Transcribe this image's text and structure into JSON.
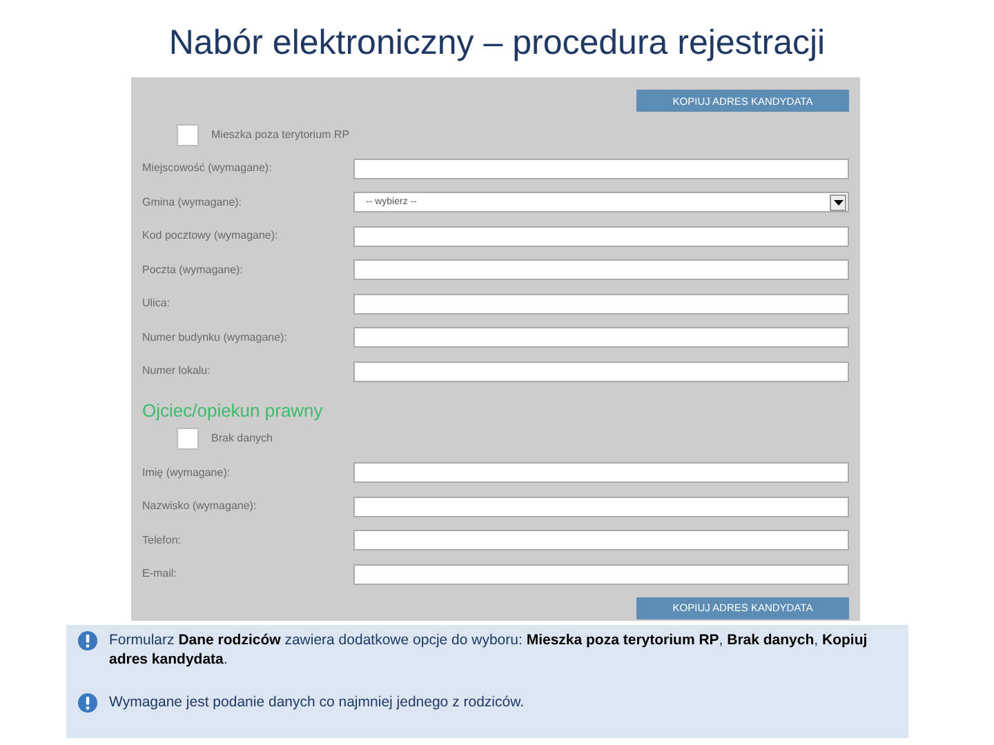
{
  "title": "Nabór elektroniczny – procedura rejestracji",
  "form": [
    {
      "kind": "button",
      "label": "KOPIUJ ADRES KANDYDATA"
    },
    {
      "kind": "checkbox",
      "label": "Mieszka poza terytorium RP",
      "checked": false
    },
    {
      "kind": "field",
      "label": "Miejscowość (wymagane):"
    },
    {
      "kind": "select",
      "label": "Gmina (wymagane):",
      "value": "-- wybierz --"
    },
    {
      "kind": "field",
      "label": "Kod pocztowy (wymagane):"
    },
    {
      "kind": "field",
      "label": "Poczta (wymagane):"
    },
    {
      "kind": "field",
      "label": "Ulica:"
    },
    {
      "kind": "field",
      "label": "Numer budynku (wymagane):"
    },
    {
      "kind": "field",
      "label": "Numer lokalu:"
    },
    {
      "kind": "heading",
      "label": "Ojciec/opiekun prawny"
    },
    {
      "kind": "checkbox",
      "label": "Brak danych",
      "checked": false
    },
    {
      "kind": "field",
      "label": "Imię (wymagane):"
    },
    {
      "kind": "field",
      "label": "Nazwisko (wymagane):"
    },
    {
      "kind": "field",
      "label": "Telefon:"
    },
    {
      "kind": "field",
      "label": "E-mail:"
    },
    {
      "kind": "button",
      "label": "KOPIUJ ADRES KANDYDATA"
    }
  ],
  "notes": [
    "Formularz **Dane rodziców** zawiera dodatkowe opcje do wyboru: **Mieszka poza terytorium RP**, **Brak danych**, **Kopiuj adres kandydata**.",
    "Wymagane jest podanie danych co najmniej jednego z rodziców."
  ]
}
